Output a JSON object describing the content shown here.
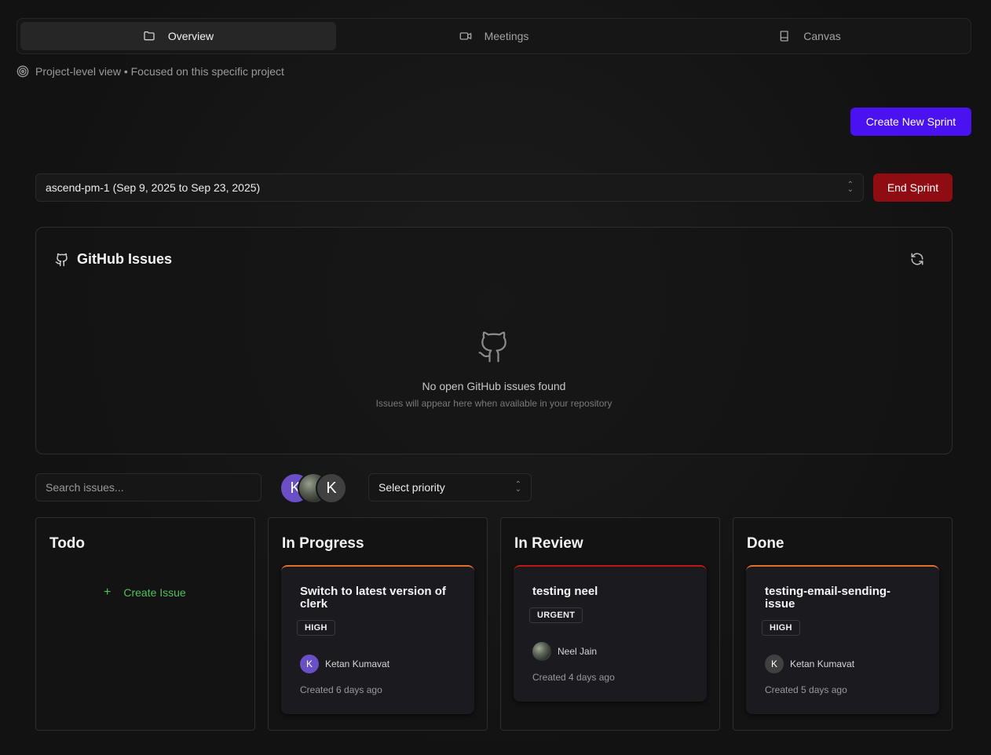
{
  "tabs": [
    {
      "label": "Overview",
      "icon": "folder-icon",
      "active": true
    },
    {
      "label": "Meetings",
      "icon": "video-icon",
      "active": false
    },
    {
      "label": "Canvas",
      "icon": "book-icon",
      "active": false
    }
  ],
  "scope_text": "Project-level view • Focused on this specific project",
  "create_sprint_label": "Create New Sprint",
  "sprint": {
    "selected": "ascend-pm-1 (Sep 9, 2025 to Sep 23, 2025)",
    "end_label": "End Sprint"
  },
  "github": {
    "title": "GitHub Issues",
    "empty_title": "No open GitHub issues found",
    "empty_sub": "Issues will appear here when available in your repository"
  },
  "filters": {
    "search_placeholder": "Search issues...",
    "avatars": [
      "K",
      "",
      "K"
    ],
    "priority_placeholder": "Select priority"
  },
  "columns": [
    {
      "title": "Todo",
      "create_label": "Create Issue"
    },
    {
      "title": "In Progress"
    },
    {
      "title": "In Review"
    },
    {
      "title": "Done"
    }
  ],
  "cards": {
    "in_progress": {
      "title": "Switch to latest version of clerk",
      "priority": "HIGH",
      "assignee": "Ketan Kumavat",
      "initial": "K",
      "created": "Created 6 days ago"
    },
    "in_review": {
      "title": "testing neel",
      "priority": "URGENT",
      "assignee": "Neel Jain",
      "created": "Created 4 days ago"
    },
    "done": {
      "title": "testing-email-sending-issue",
      "priority": "HIGH",
      "assignee": "Ketan Kumavat",
      "initial": "K",
      "created": "Created 5 days ago"
    }
  },
  "colors": {
    "primary": "#4a12f0",
    "danger": "#8e0c12",
    "create_issue": "#4fc15a",
    "high_accent": "#e0702a",
    "urgent_accent": "#c01616"
  }
}
